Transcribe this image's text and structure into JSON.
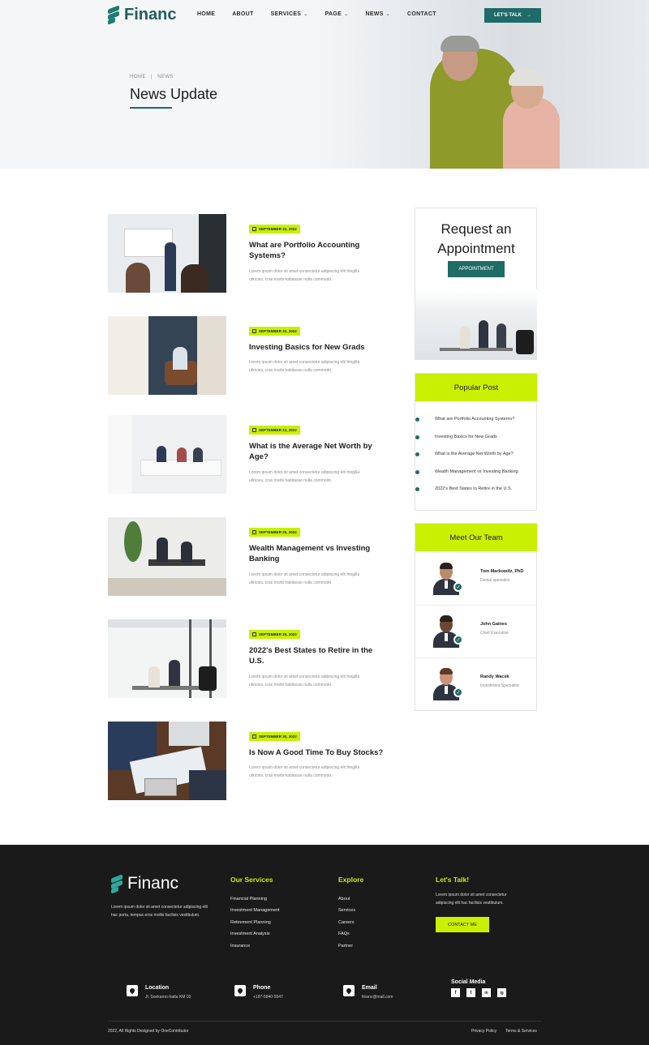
{
  "brand": {
    "name": "Financ"
  },
  "nav": {
    "items": [
      {
        "label": "HOME",
        "has_caret": false
      },
      {
        "label": "ABOUT",
        "has_caret": false
      },
      {
        "label": "SERVICES",
        "has_caret": true
      },
      {
        "label": "PAGE",
        "has_caret": true
      },
      {
        "label": "NEWS",
        "has_caret": true
      },
      {
        "label": "CONTACT",
        "has_caret": false
      }
    ],
    "cta_label": "LET'S TALK"
  },
  "hero": {
    "breadcrumb": [
      "HOME",
      "NEWS"
    ],
    "title": "News Update"
  },
  "posts": [
    {
      "date": "SEPTEMBER 22, 2022",
      "title": "What are Portfolio Accounting Systems?",
      "excerpt": "Lorem ipsum dolor sit amet consectetur adipiscing elit fringilla ultricies, cras morbi habitasse nulla commodo."
    },
    {
      "date": "SEPTEMBER 20, 2022",
      "title": "Investing Basics for New Grads",
      "excerpt": "Lorem ipsum dolor sit amet consectetur adipiscing elit fringilla ultricies, cras morbi habitasse nulla commodo."
    },
    {
      "date": "SEPTEMBER 23, 2022",
      "title": "What is the Average Net Worth by Age?",
      "excerpt": "Lorem ipsum dolor sit amet consectetur adipiscing elit fringilla ultricies, cras morbi habitasse nulla commodo."
    },
    {
      "date": "SEPTEMBER 25, 2022",
      "title": "Wealth Management vs Investing Banking",
      "excerpt": "Lorem ipsum dolor sit amet consectetur adipiscing elit fringilla ultricies, cras morbi habitasse nulla commodo."
    },
    {
      "date": "SEPTEMBER 29, 2022",
      "title": "2022's Best States to Retire in the U.S.",
      "excerpt": "Lorem ipsum dolor sit amet consectetur adipiscing elit fringilla ultricies, cras morbi habitasse nulla commodo."
    },
    {
      "date": "SEPTEMBER 30, 2022",
      "title": "Is Now A Good Time To Buy Stocks?",
      "excerpt": "Lorem ipsum dolor sit amet consectetur adipiscing elit fringilla ultricies, cras morbi habitasse nulla commodo."
    }
  ],
  "sidebar": {
    "appointment": {
      "title": "Request an Appointment",
      "button_label": "APPOINTMENT"
    },
    "popular": {
      "title": "Popular Post",
      "items": [
        "What are Portfolio Accounting Systems?",
        "Investing Basics for New Grads",
        "What is the Average Net Worth by Age?",
        "Wealth Management vs Investing Banking",
        "2022's Best States to Retire in the U.S."
      ]
    },
    "team": {
      "title": "Meet Our Team",
      "members": [
        {
          "name": "Tom Markowitz, PhD",
          "role": "Denial specialist"
        },
        {
          "name": "John Gaines",
          "role": "Chief Executive"
        },
        {
          "name": "Randy Wacek",
          "role": "Investment Specialist"
        }
      ]
    }
  },
  "footer": {
    "about": "Lorem ipsum dolor sit amet consectetur adipiscing elit hac porta, tempus eros mollis facilisis vestibulum.",
    "services": {
      "title": "Our Services",
      "links": [
        "Financial Planning",
        "Investment Management",
        "Retirement Planning",
        "Investment Analysis",
        "Insurance"
      ]
    },
    "explore": {
      "title": "Explore",
      "links": [
        "About",
        "Services",
        "Careers",
        "FAQs",
        "Partner"
      ]
    },
    "talk": {
      "title": "Let's Talk!",
      "text": "Lorem ipsum dolor sit amet consectetur adipiscing elit hac facilisis vestibulum.",
      "button_label": "CONTACT ME"
    },
    "contact": {
      "location_label": "Location",
      "location_value": "Jl. Soekarno-hatta KM 03",
      "phone_label": "Phone",
      "phone_value": "+187-5840-5547",
      "email_label": "Email",
      "email_value": "financ@mail.com"
    },
    "social": {
      "title": "Social Media",
      "icons": [
        "f",
        "t",
        "in",
        "ig"
      ]
    },
    "copyright": "2022, All Rights Designed by OneContributor",
    "privacy": "Privacy Policy",
    "terms": "Terms & Services"
  },
  "colors": {
    "accent": "#c8f000",
    "brand": "#1f6b66",
    "footer_bg": "#1a1a1a"
  }
}
